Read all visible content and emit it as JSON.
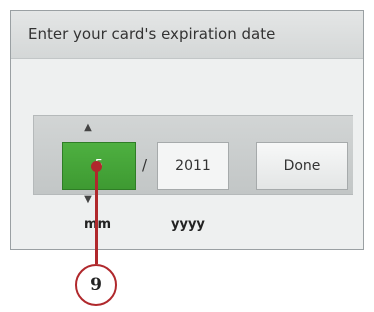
{
  "dialog": {
    "title": "Enter your card's expiration date"
  },
  "picker": {
    "month_value": "5",
    "separator": "/",
    "year_value": "2011",
    "month_label": "mm",
    "year_label": "yyyy",
    "up_arrow_icon": "chevron-up-icon",
    "down_arrow_icon": "chevron-down-icon"
  },
  "actions": {
    "done_label": "Done"
  },
  "callout": {
    "number": "9"
  },
  "colors": {
    "selected_field": "#4eb040",
    "callout": "#b0282c"
  }
}
